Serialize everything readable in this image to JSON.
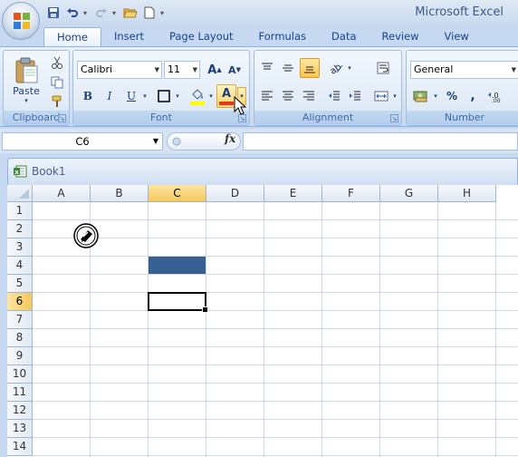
{
  "app": {
    "title": "Microsoft Excel",
    "office_button_icon": "office-logo-icon"
  },
  "quick_access": [
    {
      "name": "save-icon"
    },
    {
      "name": "undo-icon"
    },
    {
      "name": "redo-icon"
    },
    {
      "name": "open-icon"
    },
    {
      "name": "new-icon"
    },
    {
      "name": "customize-qat-icon"
    }
  ],
  "tabs": [
    {
      "label": "Home",
      "active": true
    },
    {
      "label": "Insert",
      "active": false
    },
    {
      "label": "Page Layout",
      "active": false
    },
    {
      "label": "Formulas",
      "active": false
    },
    {
      "label": "Data",
      "active": false
    },
    {
      "label": "Review",
      "active": false
    },
    {
      "label": "View",
      "active": false
    }
  ],
  "ribbon": {
    "clipboard": {
      "label": "Clipboard",
      "paste_label": "Paste"
    },
    "font": {
      "label": "Font",
      "font_name": "Calibri",
      "font_size": "11",
      "bold": "B",
      "italic": "I",
      "underline": "U",
      "font_color_letter": "A",
      "grow": "A",
      "shrink": "A",
      "font_color_bar": "#e03a1e",
      "fill_color_bar": "#ffff00"
    },
    "alignment": {
      "label": "Alignment"
    },
    "number": {
      "label": "Number",
      "format": "General",
      "percent": "%",
      "comma": ","
    }
  },
  "formula_bar": {
    "name_box": "C6",
    "fx": "fx",
    "content": ""
  },
  "workbook": {
    "title": "Book1",
    "columns": [
      "A",
      "B",
      "C",
      "D",
      "E",
      "F",
      "G",
      "H"
    ],
    "rows": [
      "1",
      "2",
      "3",
      "4",
      "5",
      "6",
      "7",
      "8",
      "9",
      "10",
      "11",
      "12",
      "13",
      "14"
    ],
    "selected_column": "C",
    "selected_row": "6",
    "active_cell": "C6",
    "filled_cell": "C4",
    "fill_color": "#376092"
  }
}
